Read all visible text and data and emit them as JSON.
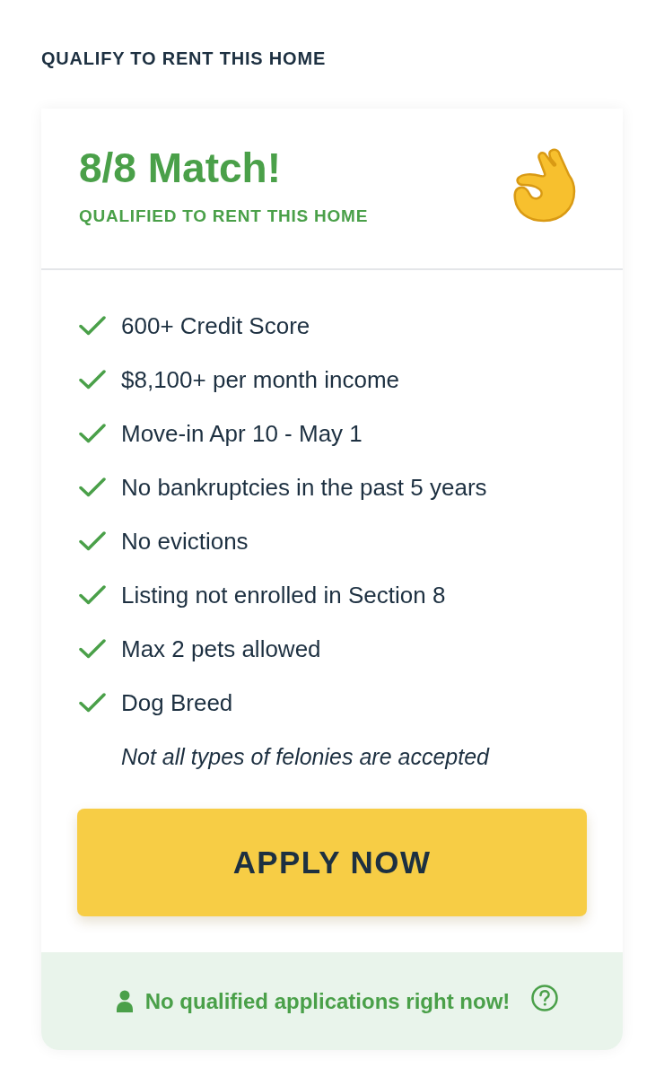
{
  "section_title": "QUALIFY TO RENT THIS HOME",
  "card": {
    "match_title": "8/8 Match!",
    "match_subtitle": "QUALIFIED TO RENT THIS HOME",
    "criteria": [
      {
        "label": "600+ Credit Score",
        "met": true
      },
      {
        "label": "$8,100+ per month income",
        "met": true
      },
      {
        "label": "Move-in Apr 10 - May 1",
        "met": true
      },
      {
        "label": "No bankruptcies in the past 5 years",
        "met": true
      },
      {
        "label": "No evictions",
        "met": true
      },
      {
        "label": "Listing not enrolled in Section 8",
        "met": true
      },
      {
        "label": "Max 2 pets allowed",
        "met": true
      },
      {
        "label": "Dog Breed",
        "met": true
      }
    ],
    "note": "Not all types of felonies are accepted",
    "apply_button": "APPLY NOW",
    "footer": {
      "message": "No qualified applications right now!"
    }
  }
}
